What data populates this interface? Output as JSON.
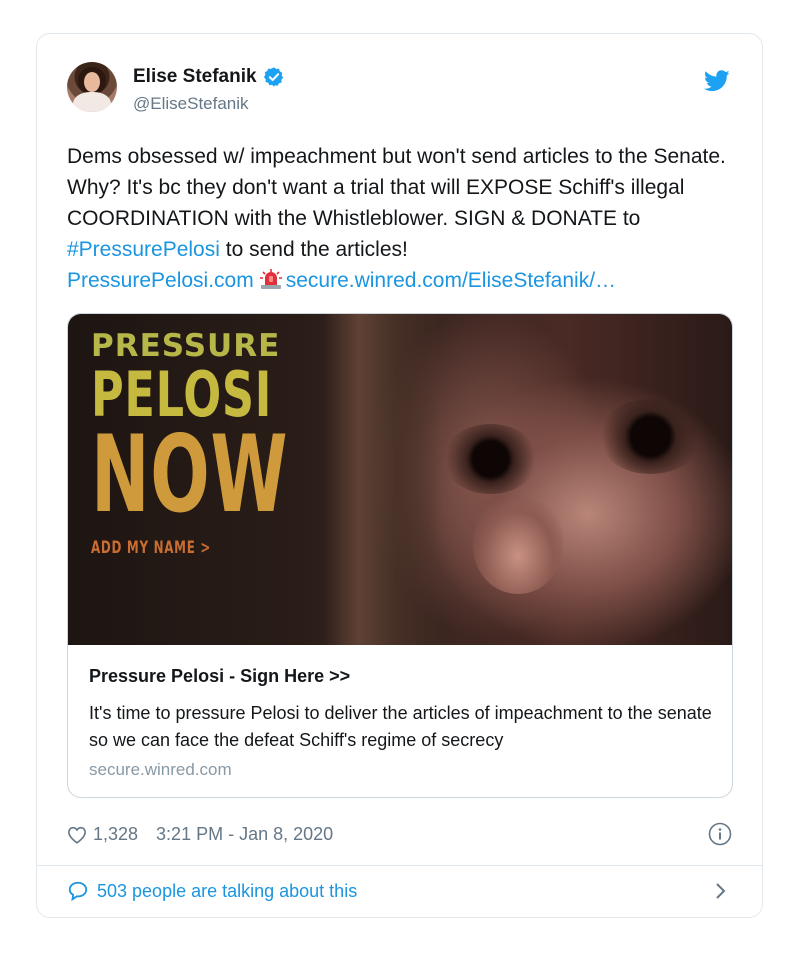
{
  "author": {
    "name": "Elise Stefanik",
    "handle": "@EliseStefanik"
  },
  "tweet": {
    "text_part1": "Dems obsessed w/ impeachment but won't send articles to the Senate. Why? It's bc they don't want a trial that will EXPOSE Schiff's illegal COORDINATION with the Whistleblower. SIGN & DONATE to ",
    "hashtag": "#PressurePelosi",
    "text_part2": " to send the articles!",
    "link1": "PressurePelosi.com",
    "link2": "secure.winred.com/EliseStefanik/…"
  },
  "card": {
    "image_line1": "PRESSURE",
    "image_line2": "PELOSI",
    "image_line3": "NOW",
    "image_line4": "ADD MY NAME >",
    "title": "Pressure Pelosi - Sign Here >>",
    "description": "It's time to pressure Pelosi to deliver the articles of impeachment to the senate so we can face the defeat Schiff's regime of secrecy",
    "domain": "secure.winred.com"
  },
  "meta": {
    "likes": "1,328",
    "timestamp": "3:21 PM - Jan 8, 2020"
  },
  "footer": {
    "talking": "503 people are talking about this"
  },
  "colors": {
    "link": "#1b95e0",
    "verified": "#1da1f2",
    "muted": "#657786"
  },
  "icons": [
    "verified-badge-icon",
    "twitter-bird-icon",
    "siren-emoji-icon",
    "heart-icon",
    "info-icon",
    "speech-bubble-icon",
    "chevron-right-icon"
  ]
}
